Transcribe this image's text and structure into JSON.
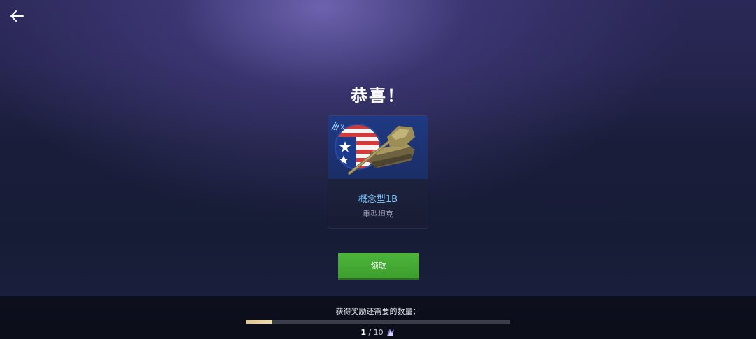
{
  "header": {
    "back_icon": "arrow-left-icon"
  },
  "title": "恭喜！",
  "reward": {
    "name": "概念型1B",
    "class": "重型坦克",
    "image": "tank-vehicle-image",
    "flag": "usa-flag",
    "tier_icon": "tier-x-icon",
    "tier_text": "X"
  },
  "claim_button": {
    "label": "领取"
  },
  "progress": {
    "label": "获得奖励还需要的数量：",
    "current": "1",
    "separator": " / ",
    "total": "10",
    "fraction": 0.1,
    "token_icon": "token-icon"
  },
  "colors": {
    "accent_name": "#7fc8ff",
    "button_green": "#45aa33",
    "progress_fill": "#e9cf9c"
  }
}
